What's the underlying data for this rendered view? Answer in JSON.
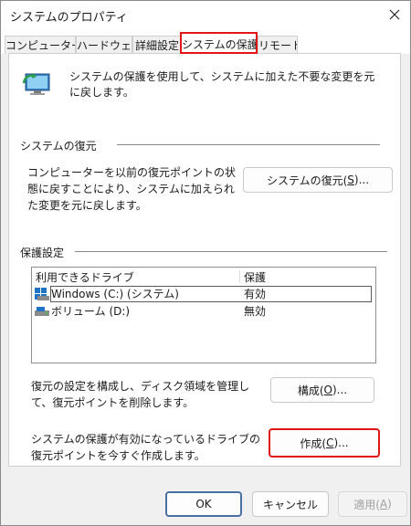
{
  "window": {
    "title": "システムのプロパティ"
  },
  "tabs": [
    {
      "label": "コンピューター名"
    },
    {
      "label": "ハードウェア"
    },
    {
      "label": "詳細設定"
    },
    {
      "label": "システムの保護"
    },
    {
      "label": "リモート"
    }
  ],
  "intro": {
    "text": "システムの保護を使用して、システムに加えた不要な変更を元に戻します。"
  },
  "restore": {
    "heading": "システムの復元",
    "description": "コンピューターを以前の復元ポイントの状態に戻すことにより、システムに加えられた変更を元に戻します。",
    "button_label": "システムの復元(",
    "button_key": "S",
    "button_suffix": ")..."
  },
  "protection": {
    "heading": "保護設定",
    "columns": {
      "drive": "利用できるドライブ",
      "protection": "保護"
    },
    "drives": [
      {
        "name": "Windows (C:) (システム)",
        "status": "有効"
      },
      {
        "name": "ボリューム (D:)",
        "status": "無効"
      }
    ],
    "configure_text": "復元の設定を構成し、ディスク領域を管理して、復元ポイントを削除します。",
    "configure_label": "構成(",
    "configure_key": "O",
    "configure_suffix": ")...",
    "create_text": "システムの保護が有効になっているドライブの復元ポイントを今すぐ作成します。",
    "create_label": "作成(",
    "create_key": "C",
    "create_suffix": ")..."
  },
  "footer": {
    "ok_label": "OK",
    "cancel_label": "キャンセル",
    "apply_label": "適用(",
    "apply_key": "A",
    "apply_suffix": ")"
  }
}
